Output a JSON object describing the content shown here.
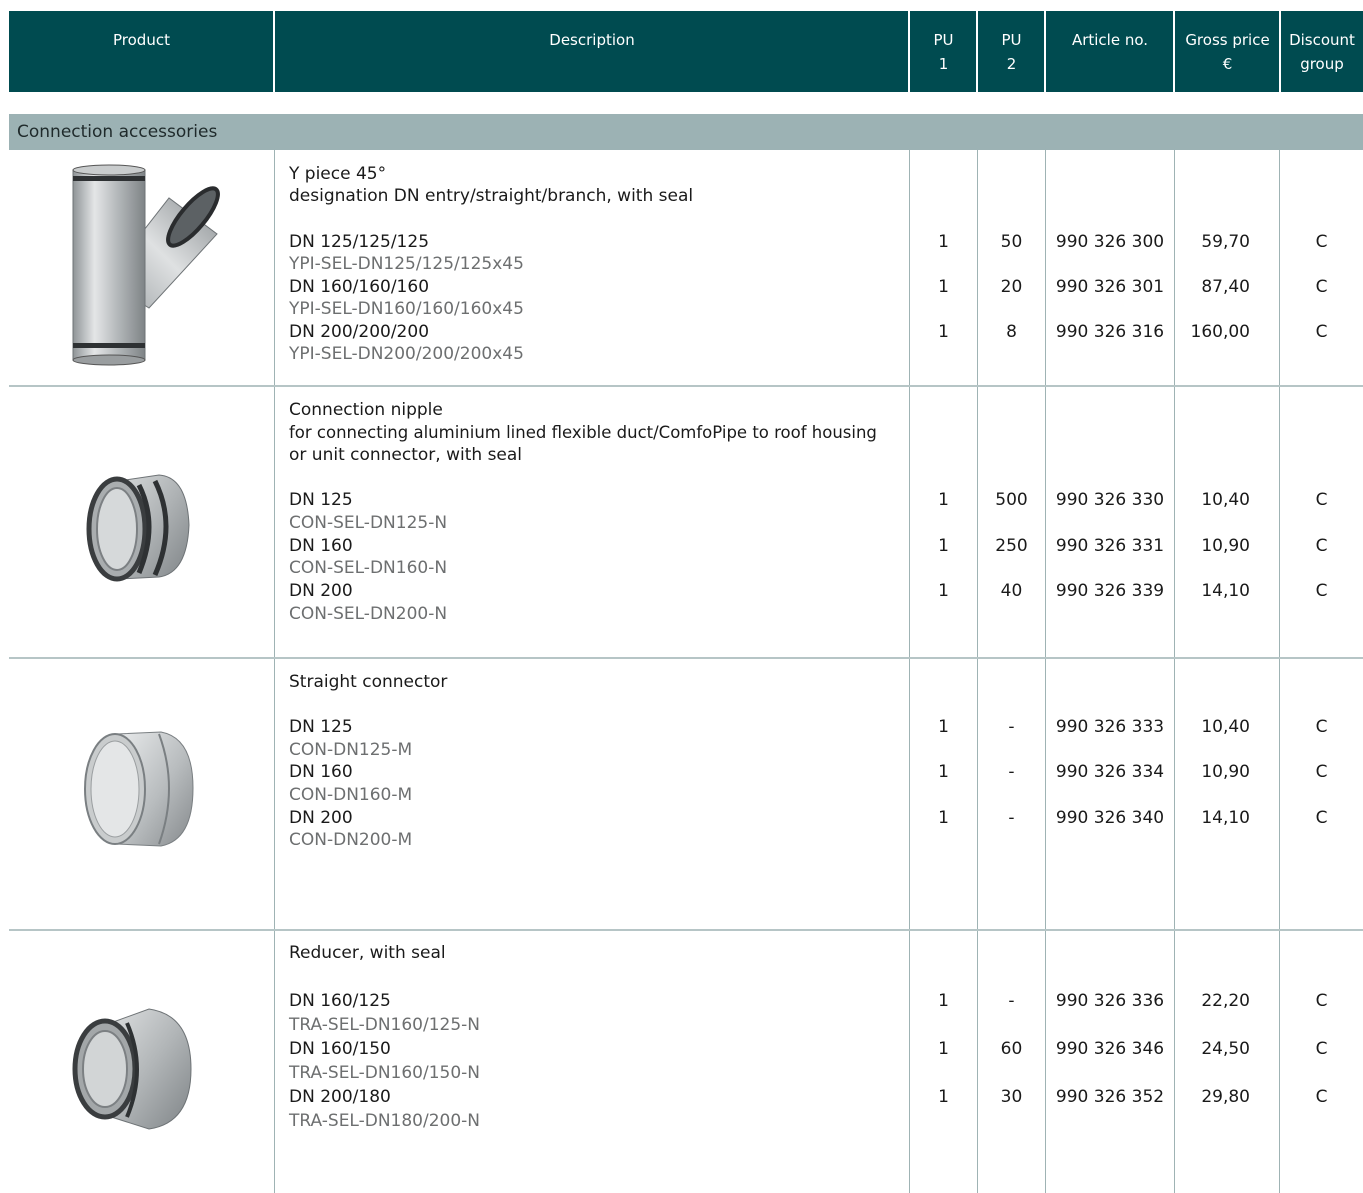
{
  "columns": {
    "product": "Product",
    "description": "Description",
    "pu1": "PU\n1",
    "pu2": "PU\n2",
    "article": "Article no.",
    "price": "Gross price\n€",
    "discount": "Discount\ngroup"
  },
  "section_title": "Connection accessories",
  "products": [
    {
      "title": "Y piece 45°",
      "subtitle": "designation DN entry/straight/branch, with seal",
      "rows": [
        {
          "dn": "DN 125/125/125",
          "code": "YPI-SEL-DN125/125/125x45",
          "pu1": "1",
          "pu2": "50",
          "article": "990 326 300",
          "price": "59,70",
          "discount": "C"
        },
        {
          "dn": "DN 160/160/160",
          "code": "YPI-SEL-DN160/160/160x45",
          "pu1": "1",
          "pu2": "20",
          "article": "990 326 301",
          "price": "87,40",
          "discount": "C"
        },
        {
          "dn": "DN 200/200/200",
          "code": "YPI-SEL-DN200/200/200x45",
          "pu1": "1",
          "pu2": "8",
          "article": "990 326 316",
          "price": "160,00",
          "discount": "C"
        }
      ]
    },
    {
      "title": "Connection nipple",
      "subtitle": "for connecting aluminium lined flexible duct/ComfoPipe to roof housing",
      "subtitle2": "or unit connector, with seal",
      "rows": [
        {
          "dn": "DN 125",
          "code": "CON-SEL-DN125-N",
          "pu1": "1",
          "pu2": "500",
          "article": "990 326 330",
          "price": "10,40",
          "discount": "C"
        },
        {
          "dn": "DN 160",
          "code": "CON-SEL-DN160-N",
          "pu1": "1",
          "pu2": "250",
          "article": "990 326 331",
          "price": "10,90",
          "discount": "C"
        },
        {
          "dn": "DN 200",
          "code": "CON-SEL-DN200-N",
          "pu1": "1",
          "pu2": "40",
          "article": "990 326 339",
          "price": "14,10",
          "discount": "C"
        }
      ]
    },
    {
      "title": "Straight connector",
      "rows": [
        {
          "dn": "DN 125",
          "code": "CON-DN125-M",
          "pu1": "1",
          "pu2": "-",
          "article": "990 326 333",
          "price": "10,40",
          "discount": "C"
        },
        {
          "dn": "DN 160",
          "code": "CON-DN160-M",
          "pu1": "1",
          "pu2": "-",
          "article": "990 326 334",
          "price": "10,90",
          "discount": "C"
        },
        {
          "dn": "DN 200",
          "code": "CON-DN200-M",
          "pu1": "1",
          "pu2": "-",
          "article": "990 326 340",
          "price": "14,10",
          "discount": "C"
        }
      ]
    },
    {
      "title": "Reducer, with seal",
      "rows": [
        {
          "dn": "DN 160/125",
          "code": "TRA-SEL-DN160/125-N",
          "pu1": "1",
          "pu2": "-",
          "article": "990 326 336",
          "price": "22,20",
          "discount": "C"
        },
        {
          "dn": "DN 160/150",
          "code": "TRA-SEL-DN160/150-N",
          "pu1": "1",
          "pu2": "60",
          "article": "990 326 346",
          "price": "24,50",
          "discount": "C"
        },
        {
          "dn": "DN 200/180",
          "code": "TRA-SEL-DN180/200-N",
          "pu1": "1",
          "pu2": "30",
          "article": "990 326 352",
          "price": "29,80",
          "discount": "C"
        }
      ]
    }
  ]
}
